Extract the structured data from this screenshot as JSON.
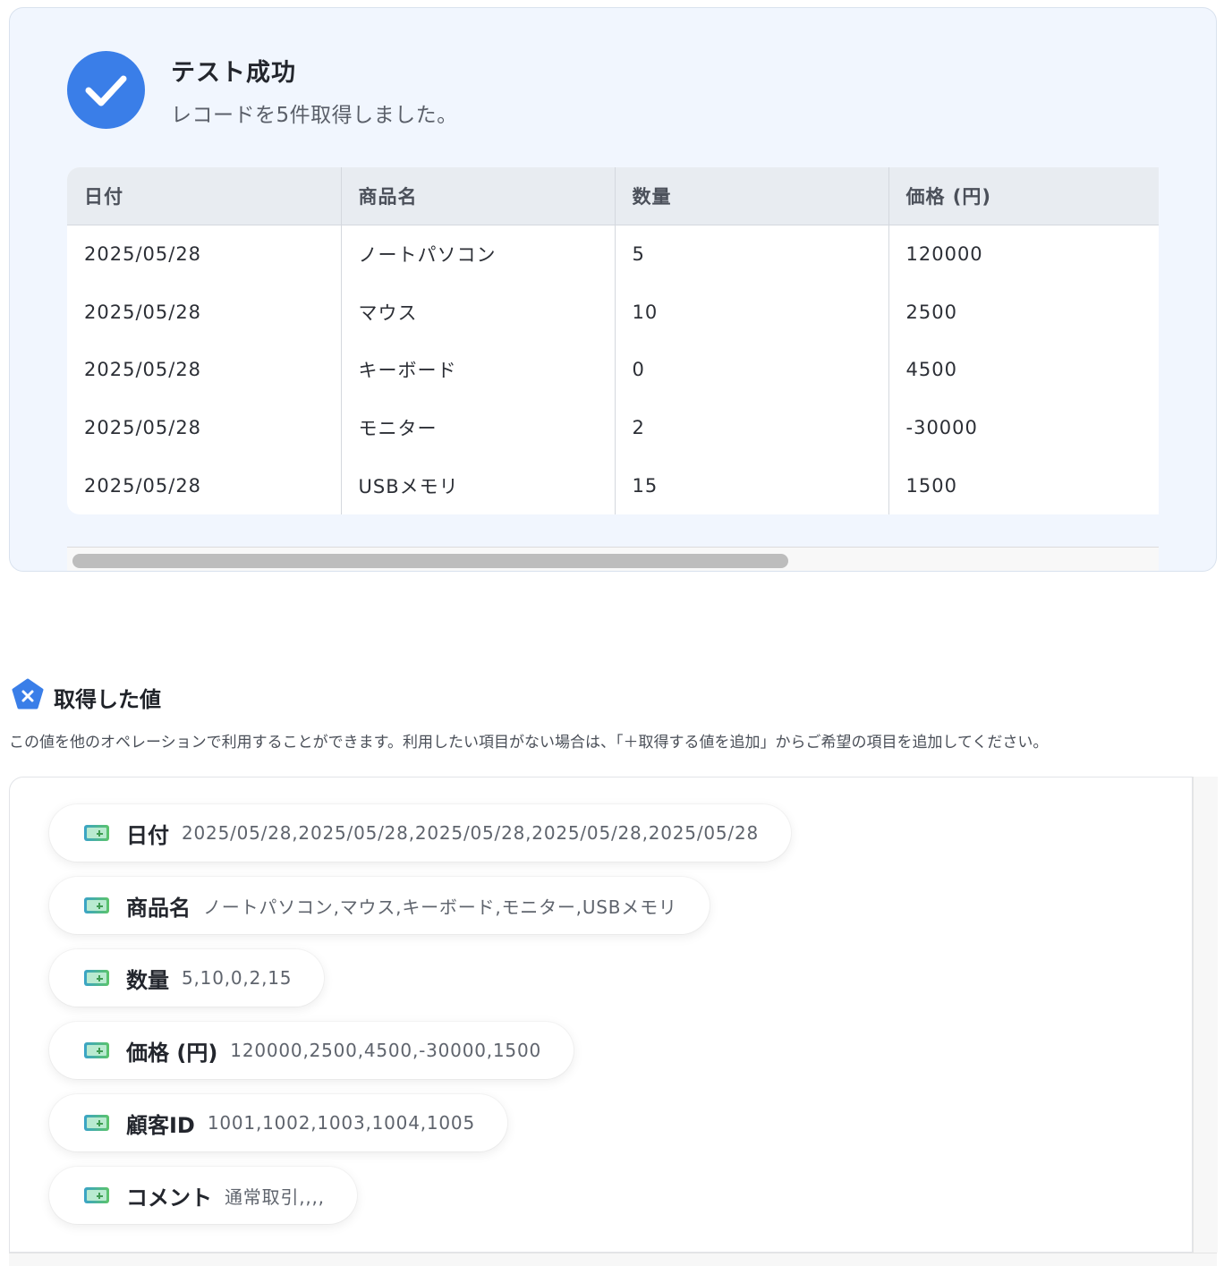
{
  "result": {
    "title": "テスト成功",
    "subtitle": "レコードを5件取得しました。",
    "columns": [
      "日付",
      "商品名",
      "数量",
      "価格 (円)"
    ],
    "rows": [
      [
        "2025/05/28",
        "ノートパソコン",
        "5",
        "120000"
      ],
      [
        "2025/05/28",
        "マウス",
        "10",
        "2500"
      ],
      [
        "2025/05/28",
        "キーボード",
        "0",
        "4500"
      ],
      [
        "2025/05/28",
        "モニター",
        "2",
        "-30000"
      ],
      [
        "2025/05/28",
        "USBメモリ",
        "15",
        "1500"
      ]
    ]
  },
  "values_section": {
    "icon": "variable-icon",
    "title": "取得した値",
    "description": "この値を他のオペレーションで利用することができます。利用したい項目がない場合は、「＋取得する値を追加」からご希望の項目を追加してください。",
    "items": [
      {
        "label": "日付",
        "value": "2025/05/28,2025/05/28,2025/05/28,2025/05/28,2025/05/28"
      },
      {
        "label": "商品名",
        "value": "ノートパソコン,マウス,キーボード,モニター,USBメモリ"
      },
      {
        "label": "数量",
        "value": "5,10,0,2,15"
      },
      {
        "label": "価格 (円)",
        "value": "120000,2500,4500,-30000,1500"
      },
      {
        "label": "顧客ID",
        "value": "1001,1002,1003,1004,1005"
      },
      {
        "label": "コメント",
        "value": "通常取引,,,,"
      }
    ]
  },
  "colors": {
    "accent": "#3a7ee8",
    "card_bg": "#f1f6fe",
    "header_bg": "#e8ecf1",
    "pill_icon": "#4cb782"
  }
}
